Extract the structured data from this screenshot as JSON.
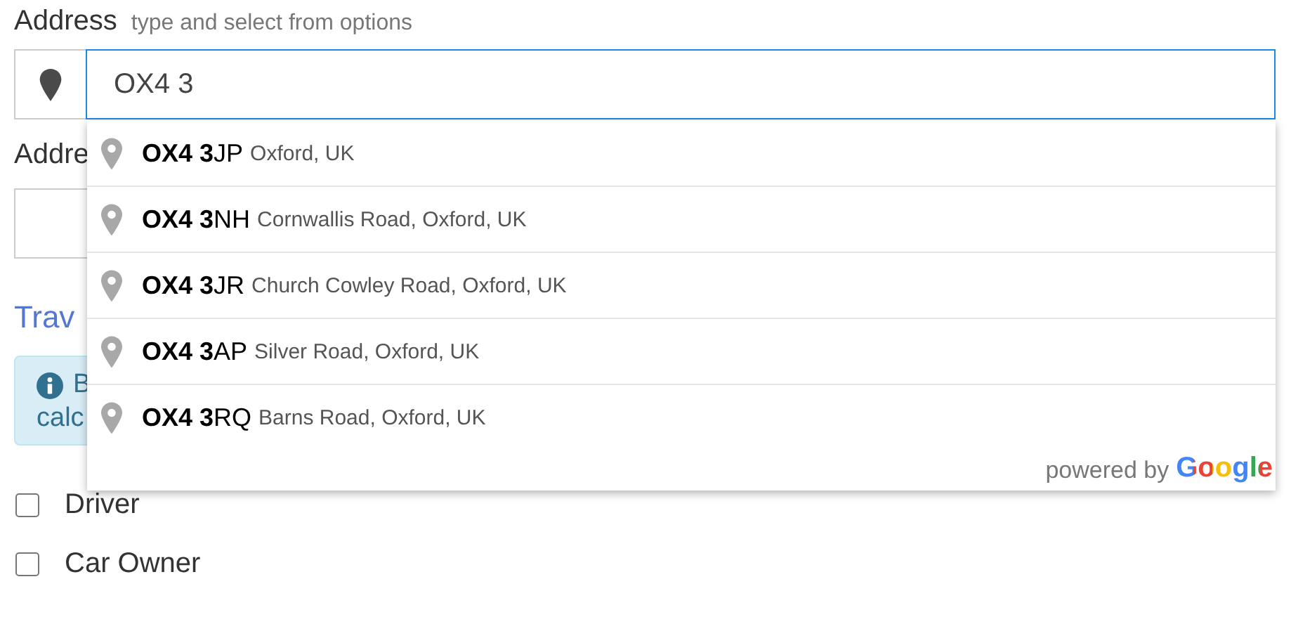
{
  "address": {
    "label": "Address",
    "hint": "type and select from options",
    "value": "OX4 3"
  },
  "suggestions": [
    {
      "main": "**OX4 3**JP",
      "detail": "Oxford, UK",
      "selected": false
    },
    {
      "main": "**OX4 3**NH",
      "detail": "Cornwallis Road, Oxford, UK",
      "selected": false
    },
    {
      "main": "**OX4 3**JR",
      "detail": "Church Cowley Road, Oxford, UK",
      "selected": false
    },
    {
      "main": "**OX4 3**AP",
      "detail": "Silver Road, Oxford, UK",
      "selected": false
    },
    {
      "main": "**OX4 3**RQ",
      "detail": "Barns Road, Oxford, UK",
      "selected": false
    }
  ],
  "attribution": {
    "text": "powered by",
    "brand": "Google"
  },
  "address_2": {
    "label": "Addre"
  },
  "section_title": "Trav",
  "alert": {
    "lines": [
      "B",
      "calc"
    ]
  },
  "checkboxes": [
    {
      "label": "Driver",
      "checked": false
    },
    {
      "label": "Car Owner",
      "checked": false
    }
  ]
}
